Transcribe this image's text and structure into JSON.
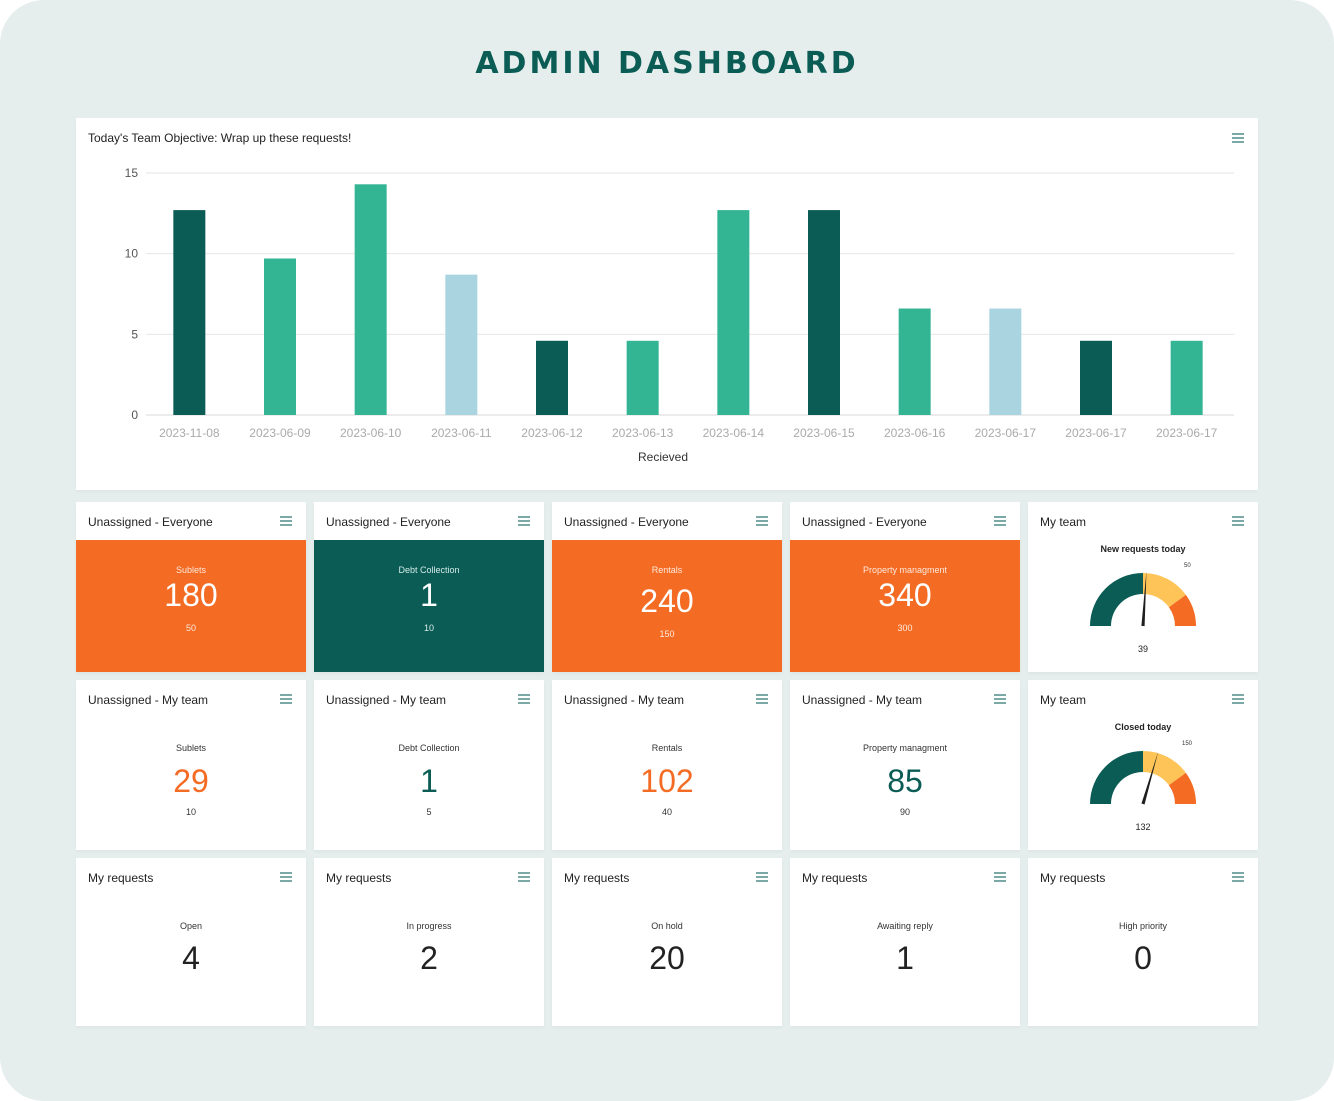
{
  "page": {
    "title": "ADMIN DASHBOARD"
  },
  "colors": {
    "dark_teal": "#0a5c55",
    "green": "#33b594",
    "light_blue": "#a9d4e0",
    "orange": "#f46b23",
    "yellow": "#ffc457",
    "menu_icon": "#7ba9a5"
  },
  "chart_card": {
    "title": "Today's Team Objective: Wrap up these requests!",
    "menu_icon": "hamburger-menu-icon"
  },
  "chart_data": {
    "type": "bar",
    "title": "Today's Team Objective: Wrap up these requests!",
    "xlabel": "Recieved",
    "ylabel": "",
    "ylim": [
      0,
      15
    ],
    "yticks": [
      0,
      5,
      10,
      15
    ],
    "grid": true,
    "legend": "none",
    "categories": [
      "2023-11-08",
      "2023-06-09",
      "2023-06-10",
      "2023-06-11",
      "2023-06-12",
      "2023-06-13",
      "2023-06-14",
      "2023-06-15",
      "2023-06-16",
      "2023-06-17",
      "2023-06-17",
      "2023-06-17"
    ],
    "values": [
      12.7,
      9.7,
      14.3,
      8.7,
      4.6,
      4.6,
      12.7,
      12.7,
      6.6,
      6.6,
      4.6,
      4.6
    ],
    "bar_colors": [
      "#0a5c55",
      "#33b594",
      "#33b594",
      "#a9d4e0",
      "#0a5c55",
      "#33b594",
      "#33b594",
      "#0a5c55",
      "#33b594",
      "#a9d4e0",
      "#0a5c55",
      "#33b594"
    ]
  },
  "row1": [
    {
      "title": "Unassigned - Everyone",
      "label": "Sublets",
      "value": "180",
      "sub": "50",
      "bg": "#f46b23"
    },
    {
      "title": "Unassigned - Everyone",
      "label": "Debt Collection",
      "value": "1",
      "sub": "10",
      "bg": "#0a5c55"
    },
    {
      "title": "Unassigned - Everyone",
      "label": "Rentals",
      "value": "240",
      "sub": "150",
      "bg": "#f46b23"
    },
    {
      "title": "Unassigned - Everyone",
      "label": "Property managment",
      "value": "340",
      "sub": "300",
      "bg": "#f46b23"
    }
  ],
  "row2": [
    {
      "title": "Unassigned - My team",
      "label": "Sublets",
      "value": "29",
      "sub": "10",
      "color": "#f46b23"
    },
    {
      "title": "Unassigned - My team",
      "label": "Debt Collection",
      "value": "1",
      "sub": "5",
      "color": "#0a5c55"
    },
    {
      "title": "Unassigned - My team",
      "label": "Rentals",
      "value": "102",
      "sub": "40",
      "color": "#f46b23"
    },
    {
      "title": "Unassigned - My team",
      "label": "Property managment",
      "value": "85",
      "sub": "90",
      "color": "#0a5c55"
    }
  ],
  "gauges": [
    {
      "title": "My team",
      "label": "New requests today",
      "value": "39",
      "max_label": "50",
      "value_fraction": 0.52,
      "bands": [
        0.5,
        0.8,
        1.0
      ]
    },
    {
      "title": "My team",
      "label": "Closed today",
      "value": "132",
      "max_label": "150",
      "value_fraction": 0.59,
      "bands": [
        0.5,
        0.8,
        1.0
      ]
    }
  ],
  "row3": [
    {
      "title": "My requests",
      "label": "Open",
      "value": "4"
    },
    {
      "title": "My requests",
      "label": "In progress",
      "value": "2"
    },
    {
      "title": "My requests",
      "label": "On hold",
      "value": "20"
    },
    {
      "title": "My requests",
      "label": "Awaiting reply",
      "value": "1"
    },
    {
      "title": "My requests",
      "label": "High priority",
      "value": "0"
    }
  ]
}
